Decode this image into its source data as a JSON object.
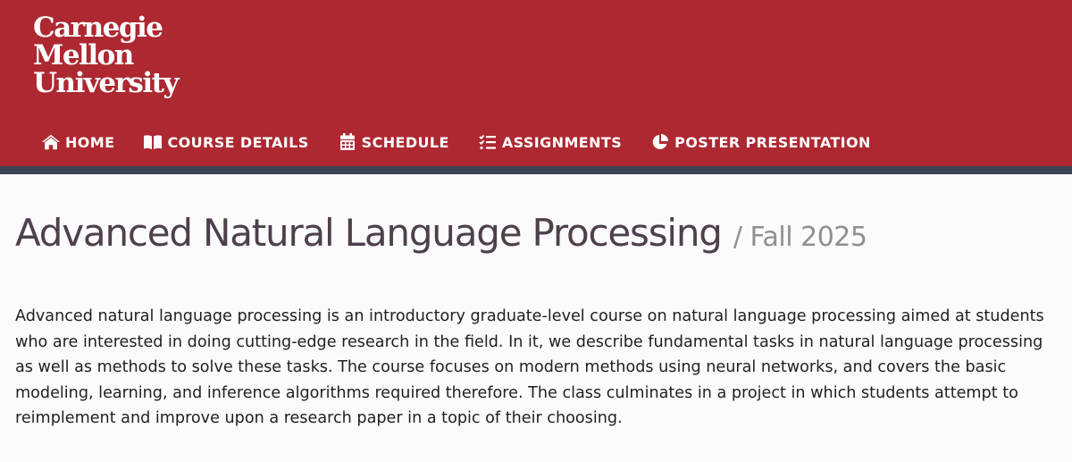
{
  "header": {
    "logo_lines": [
      "Carnegie",
      "Mellon",
      "University"
    ],
    "brand_color": "#ad2831",
    "rule_color": "#3d4556"
  },
  "nav": {
    "items": [
      {
        "label": "HOME",
        "icon": "home-icon"
      },
      {
        "label": "COURSE DETAILS",
        "icon": "book-icon"
      },
      {
        "label": "SCHEDULE",
        "icon": "calendar-icon"
      },
      {
        "label": "ASSIGNMENTS",
        "icon": "tasks-icon"
      },
      {
        "label": "POSTER PRESENTATION",
        "icon": "pie-chart-icon"
      }
    ]
  },
  "main": {
    "title": "Advanced Natural Language Processing",
    "subtitle": "/ Fall 2025",
    "description": "Advanced natural language processing is an introductory graduate-level course on natural language processing aimed at students who are interested in doing cutting-edge research in the field. In it, we describe fundamental tasks in natural language processing as well as methods to solve these tasks. The course focuses on modern methods using neural networks, and covers the basic modeling, learning, and inference algorithms required therefore. The class culminates in a project in which students attempt to reimplement and improve upon a research paper in a topic of their choosing."
  }
}
